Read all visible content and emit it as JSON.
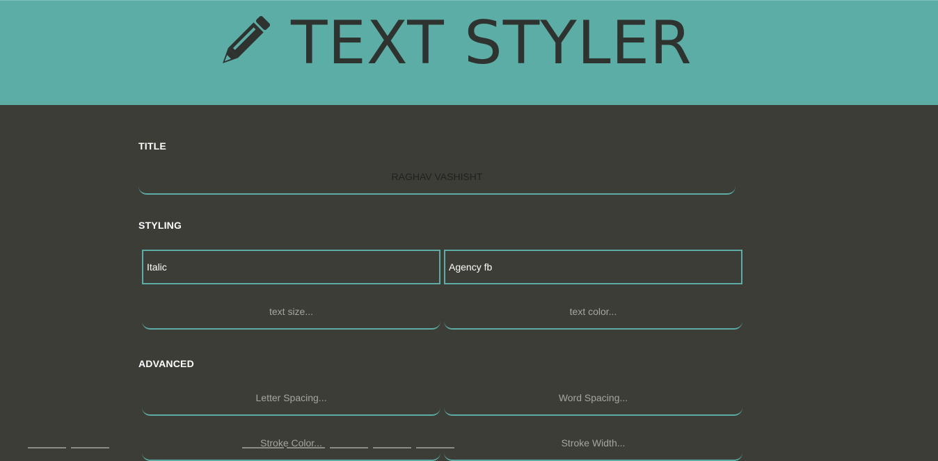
{
  "header": {
    "title": "TEXT STYLER",
    "icon": "pencil-icon",
    "background": "#5bada5"
  },
  "sections": {
    "title": {
      "label": "TITLE",
      "input_value": "RAGHAV VASHISHT"
    },
    "styling": {
      "label": "STYLING",
      "style_select": "Italic",
      "font_select": "Agency fb",
      "text_size_placeholder": "text size...",
      "text_color_placeholder": "text color..."
    },
    "advanced": {
      "label": "ADVANCED",
      "letter_spacing_placeholder": "Letter Spacing...",
      "word_spacing_placeholder": "Word Spacing...",
      "stroke_color_placeholder": "Stroke Color...",
      "stroke_width_placeholder": "Stroke Width..."
    }
  },
  "colors": {
    "accent": "#5bada5",
    "background": "#3d3d37",
    "heading_text": "#2f3330"
  }
}
